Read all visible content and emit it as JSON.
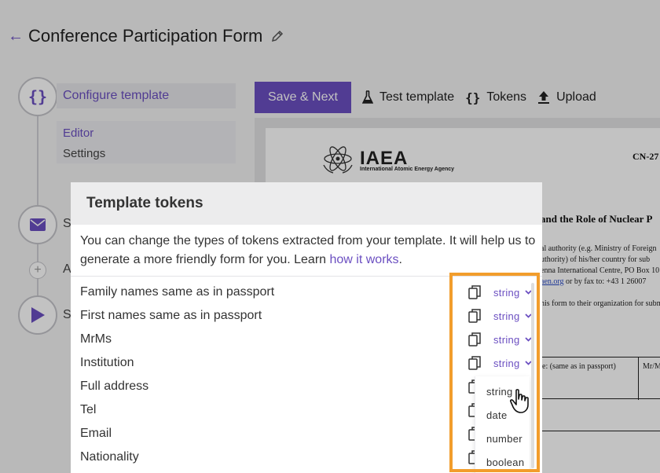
{
  "header": {
    "title": "Conference Participation Form"
  },
  "sidebar": {
    "active_step": "Configure template",
    "sub_items": [
      "Editor",
      "Settings"
    ],
    "step_letters": [
      "S",
      "A",
      "S"
    ]
  },
  "toolbar": {
    "save_next": "Save & Next",
    "test_template": "Test template",
    "tokens": "Tokens",
    "upload": "Upload"
  },
  "document": {
    "logo_text": "IAEA",
    "logo_subtext": "International Atomic Energy Agency",
    "code": "CN-27",
    "heading": "and the Role of Nuclear P",
    "lines": [
      "al authority (e.g. Ministry of Foreign",
      "uthority) of his/her country for sub",
      "enna International Centre, PO Box 10",
      "or by fax to: +43 1 26007"
    ],
    "link_text": "aen.org",
    "line5": "his form to their organization for subm",
    "table_cell_1": "e: (same as in passport)",
    "table_cell_2": "Mr/M"
  },
  "modal": {
    "title": "Template tokens",
    "description_pre": "You can change the types of tokens extracted from your template. It will help us to generate a more friendly form for you. Learn ",
    "description_link": "how it works",
    "description_post": ".",
    "tokens": [
      {
        "name": "Family names same as in passport",
        "type": "string"
      },
      {
        "name": "First names same as in passport",
        "type": "string"
      },
      {
        "name": "MrMs",
        "type": "string"
      },
      {
        "name": "Institution",
        "type": "string"
      },
      {
        "name": "Full address"
      },
      {
        "name": "Tel"
      },
      {
        "name": "Email"
      },
      {
        "name": "Nationality"
      }
    ],
    "dropdown_options": [
      "string",
      "date",
      "number",
      "boolean"
    ]
  },
  "colors": {
    "accent": "#6b4fc1",
    "highlight": "#f29d2c"
  }
}
